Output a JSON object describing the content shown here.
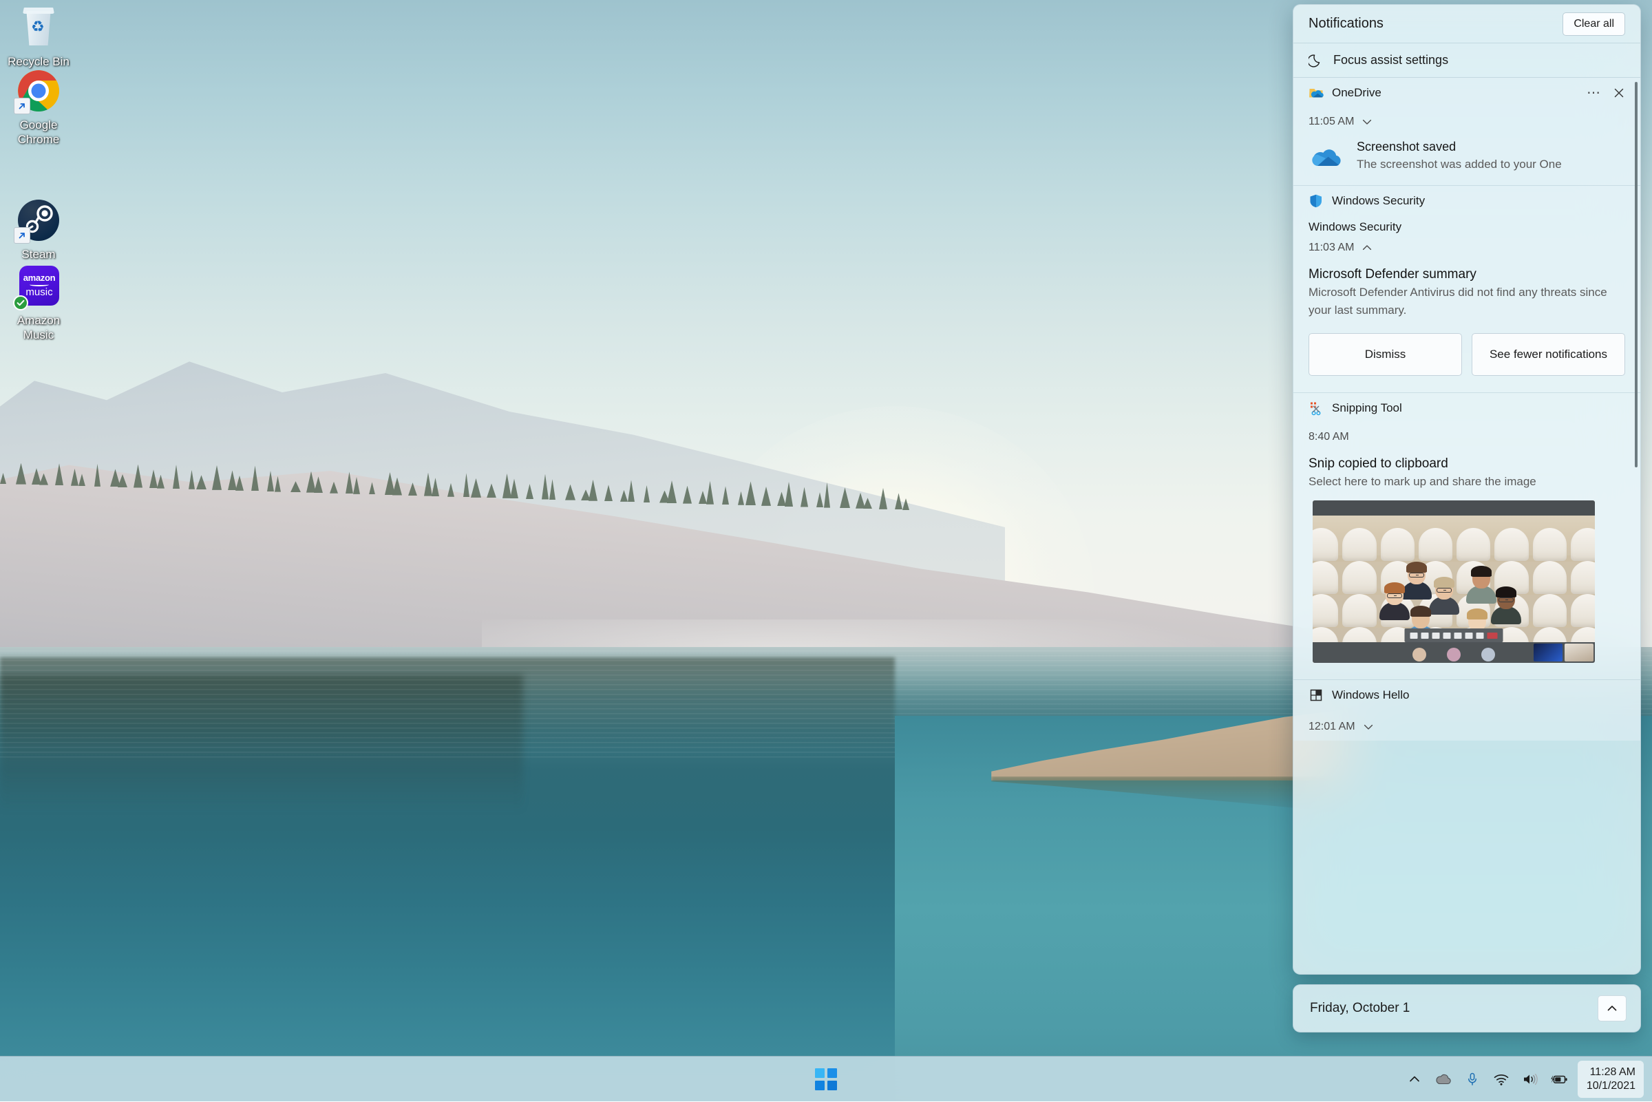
{
  "desktop": {
    "icons": [
      {
        "label": "Recycle Bin",
        "icon": "recycle-bin-icon",
        "shortcut": false,
        "sync_badge": false
      },
      {
        "label": "Google Chrome",
        "icon": "chrome-icon",
        "shortcut": true,
        "sync_badge": false
      },
      {
        "label": "Steam",
        "icon": "steam-icon",
        "shortcut": true,
        "sync_badge": false
      },
      {
        "label": "Amazon Music",
        "icon": "amazon-music-icon",
        "shortcut": false,
        "sync_badge": true
      },
      {
        "label_line1": "amazon",
        "label_line2": "music"
      }
    ]
  },
  "taskbar": {
    "start_label": "Start",
    "tray": {
      "show_hidden_label": "Show hidden icons",
      "onedrive_label": "OneDrive",
      "microphone_label": "Microphone",
      "network_label": "Network",
      "volume_label": "Volume",
      "battery_label": "Battery charging"
    },
    "clock": {
      "time": "11:28 AM",
      "date": "10/1/2021"
    }
  },
  "notification_center": {
    "header": {
      "title": "Notifications",
      "clear_all_label": "Clear all"
    },
    "focus_assist": {
      "label": "Focus assist settings",
      "icon": "moon-icon"
    },
    "groups": [
      {
        "app_name": "OneDrive",
        "app_icon": "onedrive-folder-icon",
        "has_ellipsis": true,
        "has_close": true,
        "time": "11:05 AM",
        "chevron": "chevron-down-icon",
        "headline": "Screenshot saved",
        "subtext": "The screenshot was added to your One",
        "thumb_icon": "onedrive-cloud-icon"
      },
      {
        "app_name": "Windows Security",
        "app_icon": "shield-icon",
        "second_name": "Windows Security",
        "time": "11:03 AM",
        "chevron": "chevron-up-icon",
        "headline": "Microsoft Defender summary",
        "subtext": "Microsoft Defender Antivirus did not find any threats since your last summary.",
        "actions": [
          {
            "label": "Dismiss"
          },
          {
            "label": "See fewer notifications"
          }
        ]
      },
      {
        "app_name": "Snipping Tool",
        "app_icon": "snipping-tool-icon",
        "time": "8:40 AM",
        "headline": "Snip copied to clipboard",
        "subtext": "Select here to mark up and share the image",
        "preview_alt": "Teams together mode meeting screenshot"
      },
      {
        "app_name": "Windows Hello",
        "app_icon": "windows-hello-icon",
        "time": "12:01 AM",
        "chevron": "chevron-down-icon"
      }
    ],
    "calendar": {
      "date_label": "Friday, October 1",
      "expand_icon": "chevron-up-icon"
    }
  },
  "colors": {
    "accent_blue": "#0f6cbd",
    "panel_bg": "#eef7fa",
    "taskbar_bg": "#c8dfe8",
    "water_teal": "#2f6b78",
    "amazon_purple": "#4b11d8",
    "defender_blue": "#0f6cbd"
  }
}
